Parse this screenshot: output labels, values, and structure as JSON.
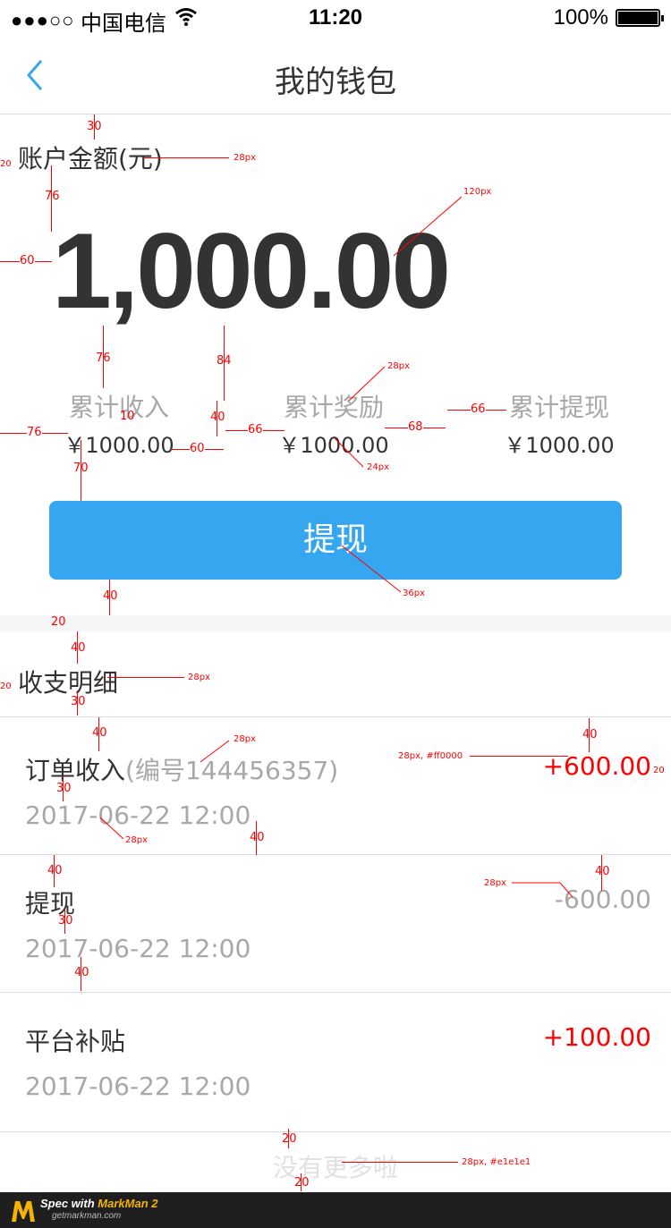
{
  "status_bar": {
    "signal": "●●●○○",
    "carrier": "中国电信",
    "time": "11:20",
    "battery": "100%"
  },
  "nav": {
    "title": "我的钱包"
  },
  "account": {
    "label": "账户金额(元)",
    "balance": "1,000.00"
  },
  "stats": [
    {
      "label": "累计收入",
      "value": "￥1000.00"
    },
    {
      "label": "累计奖励",
      "value": "￥1000.00"
    },
    {
      "label": "累计提现",
      "value": "￥1000.00"
    }
  ],
  "withdraw_button": "提现",
  "details_title": "收支明细",
  "transactions": [
    {
      "title": "订单收入",
      "sub": "(编号144456357)",
      "date": "2017-06-22 12:00",
      "amount": "+600.00",
      "amount_color": "#ff0000"
    },
    {
      "title": "提现",
      "sub": "",
      "date": "2017-06-22 12:00",
      "amount": "-600.00",
      "amount_color": "#a8a8a8"
    },
    {
      "title": "平台补贴",
      "sub": "",
      "date": "2017-06-22 12:00",
      "amount": "+100.00",
      "amount_color": "#ff0000"
    }
  ],
  "no_more": "没有更多啦",
  "annotations": {
    "a30_top": "30",
    "a28px_label": "28px",
    "a20_left": "20",
    "a76_a": "76",
    "a120px": "120px",
    "a60_left": "60",
    "a76_b": "76",
    "a84": "84",
    "a28px_stats": "28px",
    "a40_stats": "40",
    "a10": "10",
    "a76_c": "76",
    "a66_a": "66",
    "a68": "68",
    "a66_b": "66",
    "a60_b": "60",
    "a24px": "24px",
    "a70": "70",
    "a36px": "36px",
    "a40_btn": "40",
    "a20_gap": "20",
    "a40_sec": "40",
    "a28px_sec": "28px",
    "a20_sec": "20",
    "a30_sec": "30",
    "a40_tx1": "40",
    "a28px_tx1": "28px",
    "a28px_red": "28px, #ff0000",
    "a40_tx1r": "40",
    "a20_tx1r": "20",
    "a30_tx1": "30",
    "a28px_date": "28px",
    "a40_tx1b": "40",
    "a40_tx2": "40",
    "a28px_tx2": "28px",
    "a40_tx2r": "40",
    "a30_tx2": "30",
    "a40_tx2b": "40",
    "a20_nm": "20",
    "a28px_nm": "28px, #e1e1e1",
    "a20_nm2": "20"
  },
  "footer": {
    "spec_with": "Spec with ",
    "brand": "MarkMan 2",
    "url": "getmarkman.com"
  },
  "colors": {
    "accent": "#36a6f0",
    "positive": "#ff0000",
    "muted": "#a8a8a8",
    "no_more": "#e1e1e1"
  }
}
